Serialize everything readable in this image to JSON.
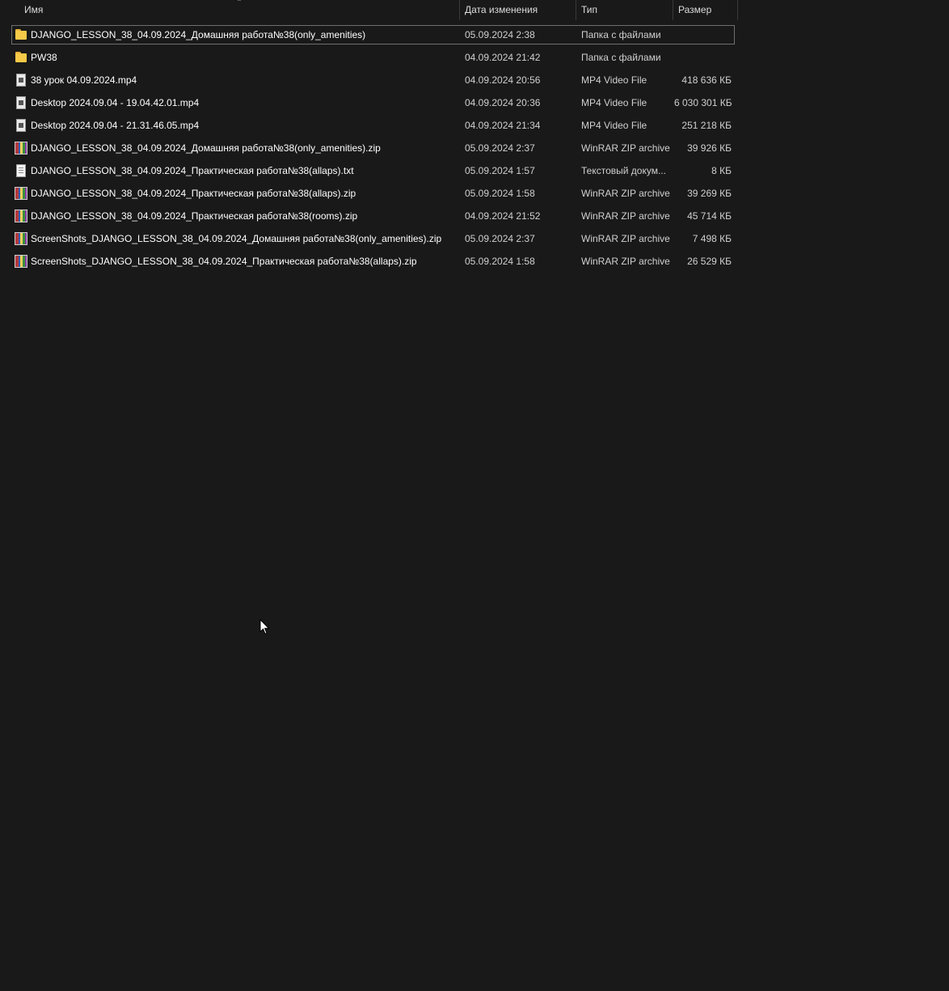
{
  "columns": {
    "name": "Имя",
    "date": "Дата изменения",
    "type": "Тип",
    "size": "Размер"
  },
  "files": [
    {
      "icon": "folder-icon",
      "name": "DJANGO_LESSON_38_04.09.2024_Домашняя работа№38(only_amenities)",
      "date": "05.09.2024 2:38",
      "type": "Папка с файлами",
      "size": ""
    },
    {
      "icon": "folder-icon",
      "name": "PW38",
      "date": "04.09.2024 21:42",
      "type": "Папка с файлами",
      "size": ""
    },
    {
      "icon": "video-file-icon",
      "name": "38 урок 04.09.2024.mp4",
      "date": "04.09.2024 20:56",
      "type": "MP4 Video File",
      "size": "418 636 КБ"
    },
    {
      "icon": "video-file-icon",
      "name": "Desktop 2024.09.04 - 19.04.42.01.mp4",
      "date": "04.09.2024 20:36",
      "type": "MP4 Video File",
      "size": "6 030 301 КБ"
    },
    {
      "icon": "video-file-icon",
      "name": "Desktop 2024.09.04 - 21.31.46.05.mp4",
      "date": "04.09.2024 21:34",
      "type": "MP4 Video File",
      "size": "251 218 КБ"
    },
    {
      "icon": "winrar-archive-icon",
      "name": "DJANGO_LESSON_38_04.09.2024_Домашняя работа№38(only_amenities).zip",
      "date": "05.09.2024 2:37",
      "type": "WinRAR ZIP archive",
      "size": "39 926 КБ"
    },
    {
      "icon": "text-file-icon",
      "name": "DJANGO_LESSON_38_04.09.2024_Практическая работа№38(allaps).txt",
      "date": "05.09.2024 1:57",
      "type": "Текстовый докум...",
      "size": "8 КБ"
    },
    {
      "icon": "winrar-archive-icon",
      "name": "DJANGO_LESSON_38_04.09.2024_Практическая работа№38(allaps).zip",
      "date": "05.09.2024 1:58",
      "type": "WinRAR ZIP archive",
      "size": "39 269 КБ"
    },
    {
      "icon": "winrar-archive-icon",
      "name": "DJANGO_LESSON_38_04.09.2024_Практическая работа№38(rooms).zip",
      "date": "04.09.2024 21:52",
      "type": "WinRAR ZIP archive",
      "size": "45 714 КБ"
    },
    {
      "icon": "winrar-archive-icon",
      "name": "ScreenShots_DJANGO_LESSON_38_04.09.2024_Домашняя работа№38(only_amenities).zip",
      "date": "05.09.2024 2:37",
      "type": "WinRAR ZIP archive",
      "size": "7 498 КБ"
    },
    {
      "icon": "winrar-archive-icon",
      "name": "ScreenShots_DJANGO_LESSON_38_04.09.2024_Практическая работа№38(allaps).zip",
      "date": "05.09.2024 1:58",
      "type": "WinRAR ZIP archive",
      "size": "26 529 КБ"
    }
  ]
}
